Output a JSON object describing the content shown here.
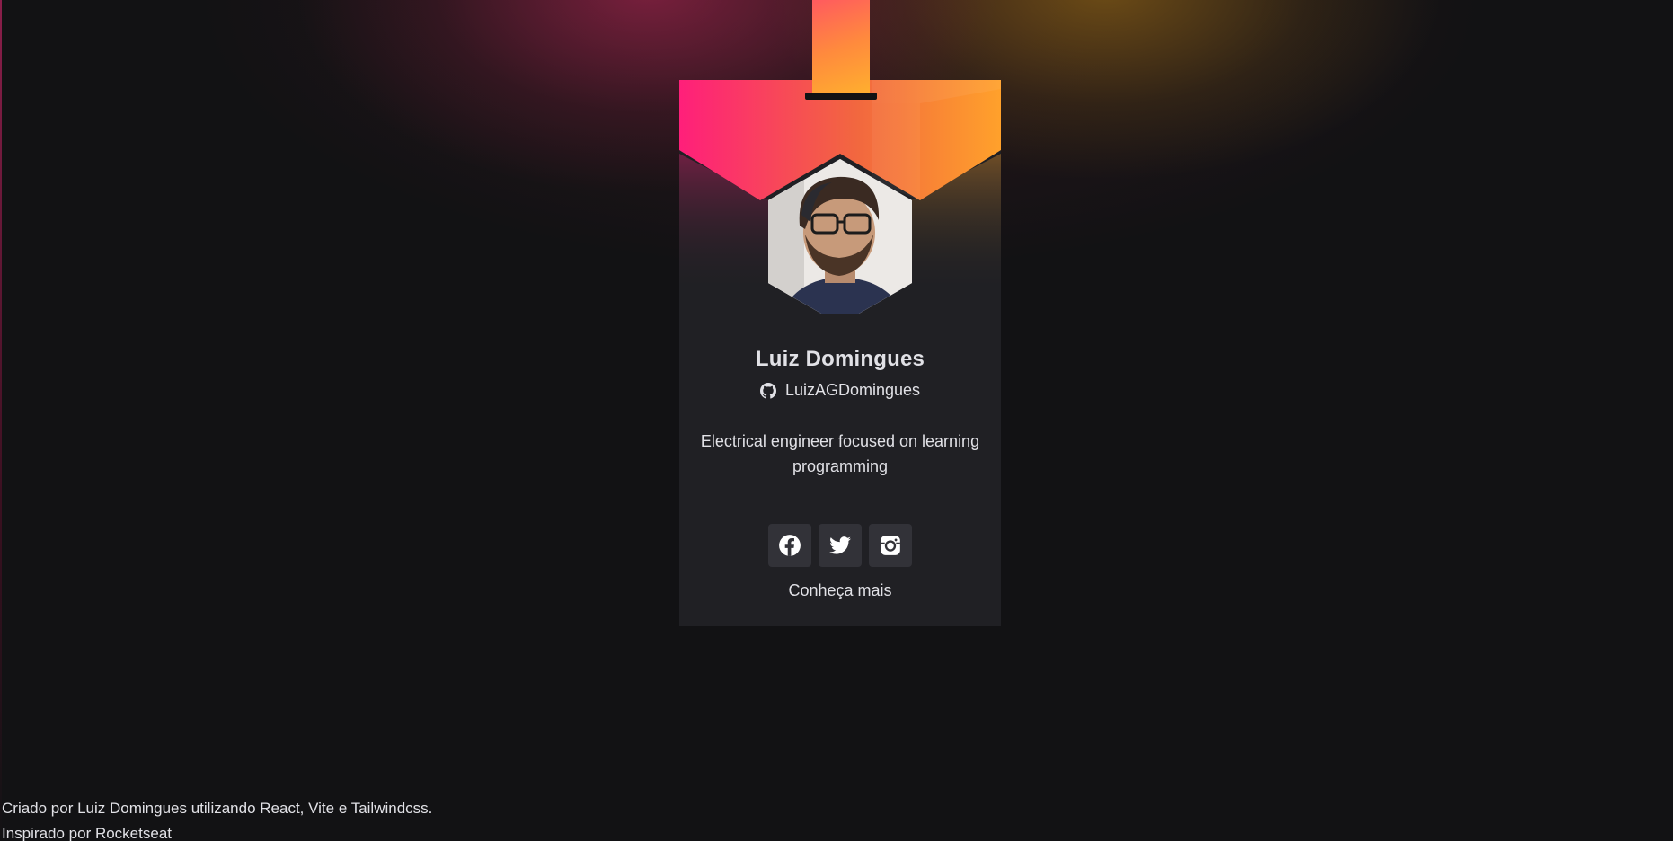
{
  "profile": {
    "name": "Luiz Domingues",
    "github_user": "LuizAGDomingues",
    "bio": "Electrical engineer focused on learning programming",
    "more_link": "Conheça mais"
  },
  "socials": [
    {
      "icon": "facebook-icon"
    },
    {
      "icon": "twitter-icon"
    },
    {
      "icon": "instagram-icon"
    }
  ],
  "footer": {
    "line1": "Criado por Luiz Domingues utilizando React, Vite e Tailwindcss.",
    "line2": "Inspirado por Rocketseat"
  },
  "colors": {
    "background": "#121214",
    "card": "#202024",
    "button": "#323238",
    "gradient_start": "#ff1f7a",
    "gradient_end": "#ffa12b",
    "text": "#e1e1e6"
  }
}
